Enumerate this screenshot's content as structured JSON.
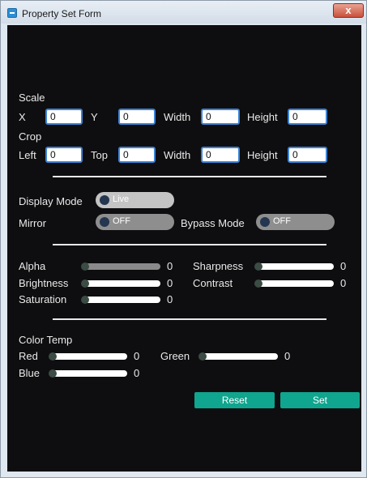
{
  "window": {
    "title": "Property Set Form",
    "close_label": "x"
  },
  "scale": {
    "heading": "Scale",
    "x_label": "X",
    "x_value": "0",
    "y_label": "Y",
    "y_value": "0",
    "width_label": "Width",
    "width_value": "0",
    "height_label": "Height",
    "height_value": "0"
  },
  "crop": {
    "heading": "Crop",
    "left_label": "Left",
    "left_value": "0",
    "top_label": "Top",
    "top_value": "0",
    "width_label": "Width",
    "width_value": "0",
    "height_label": "Height",
    "height_value": "0"
  },
  "display": {
    "display_mode_label": "Display Mode",
    "display_mode_value": "Live",
    "mirror_label": "Mirror",
    "mirror_value": "OFF",
    "bypass_label": "Bypass Mode",
    "bypass_value": "OFF"
  },
  "image": {
    "alpha_label": "Alpha",
    "alpha_value": "0",
    "sharpness_label": "Sharpness",
    "sharpness_value": "0",
    "brightness_label": "Brightness",
    "brightness_value": "0",
    "contrast_label": "Contrast",
    "contrast_value": "0",
    "saturation_label": "Saturation",
    "saturation_value": "0"
  },
  "color_temp": {
    "heading": "Color Temp",
    "red_label": "Red",
    "red_value": "0",
    "green_label": "Green",
    "green_value": "0",
    "blue_label": "Blue",
    "blue_value": "0"
  },
  "buttons": {
    "reset_label": "Reset",
    "set_label": "Set"
  },
  "colors": {
    "accent": "#0fa58e",
    "field_border": "#3c83d6",
    "background": "#0e0e10"
  }
}
